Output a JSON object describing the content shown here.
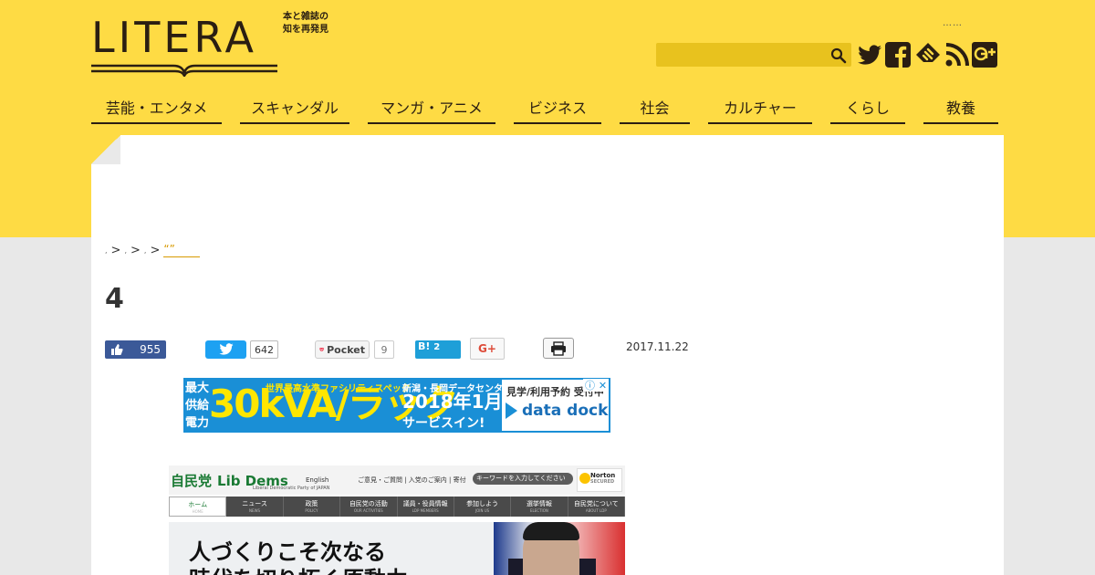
{
  "header": {
    "logo_text": "LITERA",
    "tagline_line1": "本と雑誌の",
    "tagline_line2": "知を再発見",
    "dots": "……",
    "search": {
      "placeholder": ""
    }
  },
  "colors": {
    "brand_yellow": "#fedb44",
    "dark": "#2a1e12",
    "accent_orange": "#d89a00"
  },
  "social_icons": [
    "twitter-icon",
    "facebook-icon",
    "feedly-icon",
    "rss-icon",
    "google-plus-icon"
  ],
  "nav": [
    {
      "label": "芸能・エンタメ"
    },
    {
      "label": "スキャンダル"
    },
    {
      "label": "マンガ・アニメ"
    },
    {
      "label": "ビジネス"
    },
    {
      "label": "社会"
    },
    {
      "label": "カルチャー"
    },
    {
      "label": "くらし"
    },
    {
      "label": "教養"
    }
  ],
  "breadcrumb": {
    "sep": ">",
    "current": "“”"
  },
  "article": {
    "title": "4",
    "date": "2017.11.22"
  },
  "share": {
    "facebook_count": "955",
    "twitter_count": "642",
    "pocket_label": "Pocket",
    "pocket_count": "9",
    "hatena_label": "B!",
    "hatena_count": "2",
    "gplus_label": "G+"
  },
  "ad": {
    "left_text": "最大供給電力",
    "big_text": "30kVA/ラック",
    "spec_text": "世界最高水準ファシリティスペック",
    "dc_text": "新潟・長岡データセンター",
    "year_text": "2018年1月",
    "service_text": "サービスイン!",
    "visit_text": "見学/利用予約 受付中",
    "brand_text": "data dock"
  },
  "screenshot": {
    "logo": "自民党",
    "logo_en": "Lib Dems",
    "logo_sub": "Liberal Democratic Party of JAPAN",
    "english": "English",
    "links": "ご意見・ご質問 | 入党のご案内 | 寄付",
    "search": "キーワードを入力してください",
    "norton": "Norton",
    "norton_sub": "SECURED",
    "nav": [
      {
        "label": "ホーム",
        "sub": "HOME"
      },
      {
        "label": "ニュース",
        "sub": "NEWS"
      },
      {
        "label": "政策",
        "sub": "POLICY"
      },
      {
        "label": "自民党の活動",
        "sub": "OUR ACTIVITIES"
      },
      {
        "label": "議員・役員情報",
        "sub": "LDP MEMBERS"
      },
      {
        "label": "参加しよう",
        "sub": "JOIN US"
      },
      {
        "label": "選挙情報",
        "sub": "ELECTION"
      },
      {
        "label": "自民党について",
        "sub": "ABOUT LDP"
      }
    ],
    "hero_line1": "人づくりこそ次なる",
    "hero_line2": "時代を切り拓く原動力"
  }
}
